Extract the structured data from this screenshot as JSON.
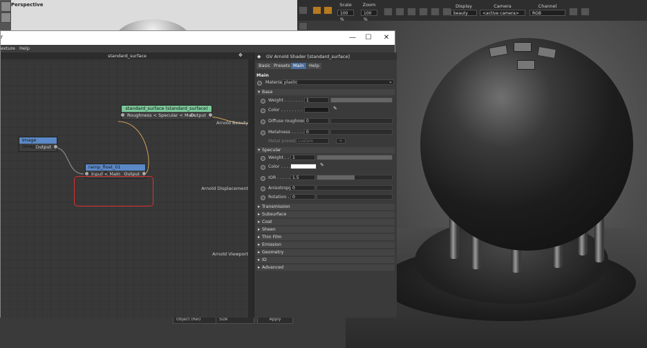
{
  "viewport": {
    "label": "Perspective"
  },
  "render_toolbar": {
    "scale_label": "Scale",
    "scale_value": "100 %",
    "zoom_label": "Zoom",
    "zoom_value": "100 %",
    "display_label": "Display",
    "display_value": "beauty",
    "camera_label": "Camera",
    "camera_value": "<active camera>",
    "channel_label": "Channel",
    "channel_value": "RGB"
  },
  "window": {
    "title_fragment": "r",
    "minimize": "—",
    "maximize": "☐",
    "close": "✕",
    "menu": [
      "exture",
      "Help"
    ]
  },
  "graph": {
    "title": "standard_surface",
    "nodes": {
      "standard_surface": {
        "title": "standard_surface (standard_surface)",
        "input": "Roughness < Specular < Main",
        "output": "Output"
      },
      "image": {
        "title": "Image (image)",
        "output": "Output"
      },
      "ramp": {
        "title": "ramp_float_01 (ramp_float)",
        "input": "Input < Main",
        "output": "Output"
      }
    },
    "labels": {
      "beauty": "Arnold Beauty",
      "displacement": "Arnold Displacement",
      "viewport": "Arnold Viewport"
    }
  },
  "attributes": {
    "title": "GV Arnold Shader [standard_surface]",
    "tabs": [
      "Basic",
      "Presets",
      "Main",
      "Help"
    ],
    "active_tab": "Main",
    "main_header": "Main",
    "material_label": "Material",
    "material_value": "plastic",
    "base": {
      "header": "Base",
      "weight_label": "Weight . . . . . . .",
      "weight_value": "1",
      "weight_level": 1.0,
      "color_label": "Color . . . . . . . .",
      "diffuse_label": "Diffuse roughness",
      "diffuse_value": "0",
      "diffuse_level": 0.0,
      "metalness_label": "Metalness . . . . .",
      "metalness_value": "0",
      "metalness_level": 0.0,
      "metal_presets_label": "Metal presets",
      "metal_presets_value": "custom",
      "metal_presets_btn": "+"
    },
    "specular": {
      "header": "Specular",
      "weight_label": "Weight . . . . .",
      "weight_value": "1",
      "weight_level": 1.0,
      "color_label": "Color . . . . . . .",
      "ior_label": "IOR . . . . . .",
      "ior_value": "1.5",
      "ior_level": 0.5,
      "anisotropy_label": "Anisotropy",
      "anisotropy_value": "0",
      "anisotropy_level": 0.0,
      "rotation_label": "Rotation . . .",
      "rotation_value": "0",
      "rotation_level": 0.0
    },
    "sections": [
      "Transmission",
      "Subsurface",
      "Coat",
      "Sheen",
      "Thin Film",
      "Emission",
      "Geometry",
      "ID",
      "Advanced"
    ]
  },
  "bottom": {
    "select1": "Object (Rel)",
    "select2": "Size",
    "apply": "Apply"
  },
  "colors": {
    "node_green": "#7cc79a",
    "node_blue": "#5b89c7",
    "node_red": "#d2574b",
    "highlight": "#e03030",
    "tab_active": "#4b6d9a",
    "accent_orange": "#b87a1e"
  }
}
